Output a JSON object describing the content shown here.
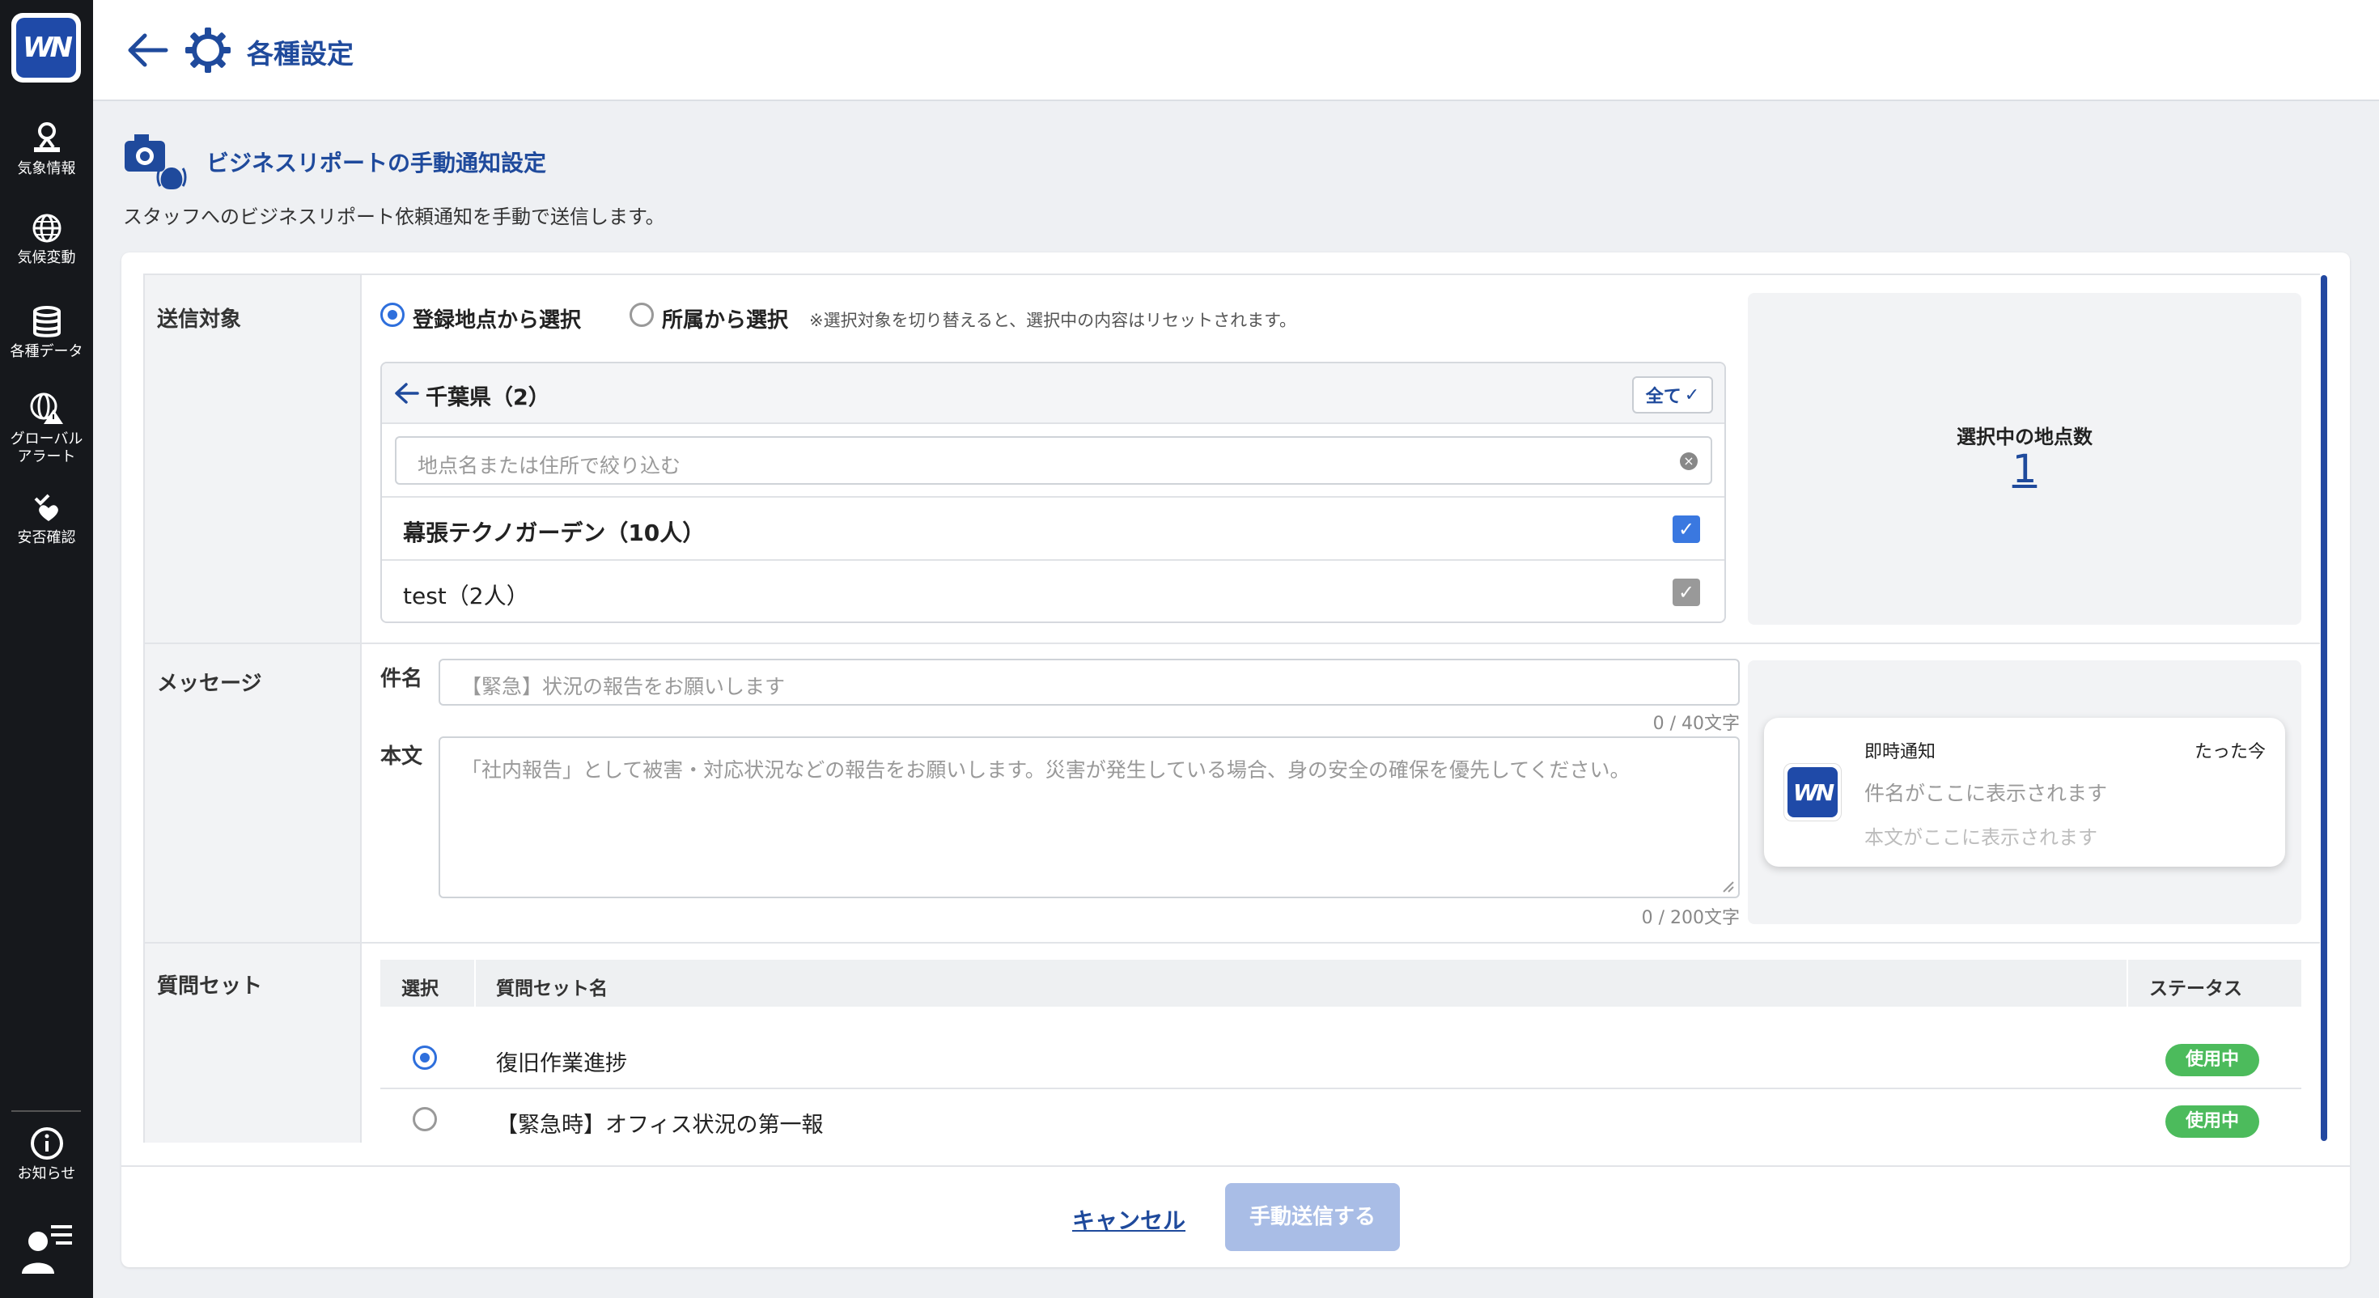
{
  "sidebar": {
    "logo_text": "WN",
    "items": [
      {
        "label": "気象情報",
        "icon": "weather-map-pin-icon"
      },
      {
        "label": "気候変動",
        "icon": "globe-icon"
      },
      {
        "label": "各種データ",
        "icon": "database-icon"
      },
      {
        "label_line1": "グローバル",
        "label_line2": "アラート",
        "icon": "global-alert-icon"
      },
      {
        "label": "安否確認",
        "icon": "safety-check-icon"
      }
    ],
    "notice_label": "お知らせ",
    "notice_icon": "info-icon",
    "user_icon": "user-menu-icon"
  },
  "header": {
    "title": "各種設定"
  },
  "section": {
    "title": "ビジネスリポートの手動通知設定",
    "description": "スタッフへのビジネスリポート依頼通知を手動で送信します。"
  },
  "target": {
    "label": "送信対象",
    "option_location": "登録地点から選択",
    "option_affiliation": "所属から選択",
    "note": "※選択対象を切り替えると、選択中の内容はリセットされます。",
    "prefecture": "千葉県（2）",
    "all_button": "全て",
    "filter_placeholder": "地点名または住所で絞り込む",
    "locations": [
      {
        "name": "幕張テクノガーデン（10人）",
        "checked": true
      },
      {
        "name": "test（2人）",
        "checked": true
      }
    ],
    "count_label": "選択中の地点数",
    "count_value": "1"
  },
  "message": {
    "label": "メッセージ",
    "subject_label": "件名",
    "subject_placeholder": "【緊急】状況の報告をお願いします",
    "subject_counter": "0 / 40文字",
    "body_label": "本文",
    "body_placeholder": "「社内報告」として被害・対応状況などの報告をお願いします。災害が発生している場合、身の安全の確保を優先してください。",
    "body_counter": "0 / 200文字"
  },
  "preview": {
    "app_name": "即時通知",
    "time": "たった今",
    "subject_ph": "件名がここに表示されます",
    "body_ph": "本文がここに表示されます"
  },
  "question_sets": {
    "label": "質問セット",
    "col_select": "選択",
    "col_name": "質問セット名",
    "col_status": "ステータス",
    "rows": [
      {
        "name": "復旧作業進捗",
        "status": "使用中",
        "selected": true
      },
      {
        "name": "【緊急時】オフィス状況の第一報",
        "status": "使用中",
        "selected": false
      }
    ]
  },
  "footer": {
    "cancel": "キャンセル",
    "submit": "手動送信する"
  },
  "colors": {
    "brand": "#1f4a9c",
    "accent": "#2e6fdc",
    "status_green": "#4cbb5c",
    "submit_disabled": "#a9bde6"
  }
}
